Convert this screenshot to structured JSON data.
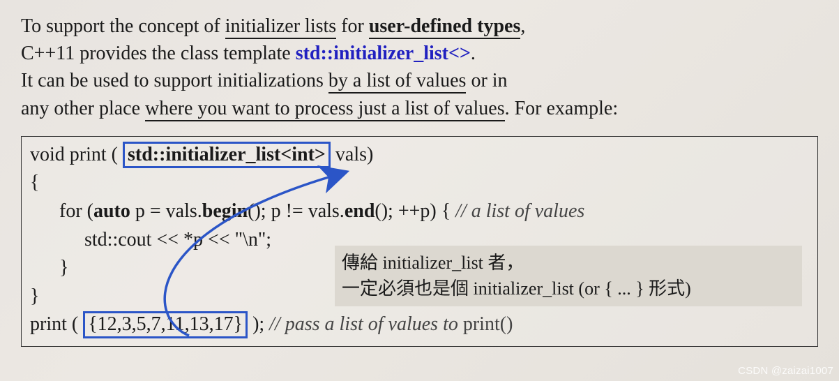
{
  "intro": {
    "l1a": "To support the concept of ",
    "l1b": "initializer lists",
    "l1c": " for ",
    "l1d": "user-defined types",
    "l1e": ",",
    "l2a": "C++11 provides the class template ",
    "l2b": "std::initializer_list<>",
    "l2c": ".",
    "l3a": "It can be used to support initializations ",
    "l3b": "by a list of values",
    "l3c": " or in",
    "l4a": "any other place ",
    "l4b": "where you want to process just a list of values",
    "l4c": ". For example:"
  },
  "code": {
    "sig_a": "void  print  ( ",
    "sig_type": "std::initializer_list<int>",
    "sig_b": "  vals)",
    "brace_open": "{",
    "for_a": "for  (",
    "for_auto": "auto",
    "for_b": "  p = vals.",
    "for_begin": "begin",
    "for_c": "();   p != vals.",
    "for_end": "end",
    "for_d": "();   ++p)  {   ",
    "for_cm": "// a  list of values",
    "cout": "std::cout  <<  *p  <<  \"\\n\";",
    "for_close": "}",
    "brace_close": "}",
    "call_a": "print  ( ",
    "call_arg": "{12,3,5,7,11,13,17}",
    "call_b": " );   ",
    "call_cm_i": "// pass a list of values to ",
    "call_cm_r": "print()"
  },
  "note": {
    "l1": "傳給 initializer_list 者，",
    "l2": "一定必須也是個 initializer_list (or { ... } 形式)"
  },
  "watermark": "CSDN @zaizai1007"
}
